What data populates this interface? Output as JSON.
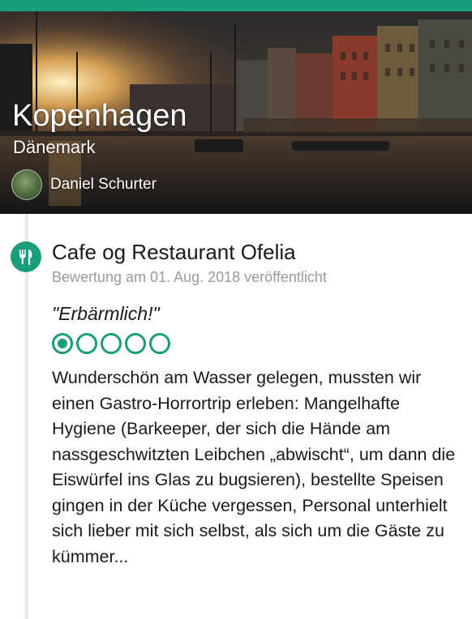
{
  "colors": {
    "accent": "#1a9d7a",
    "muted_text": "#9a9a9a",
    "text": "#1a1a1a"
  },
  "hero": {
    "city": "Kopenhagen",
    "country": "Dänemark",
    "author": "Daniel Schurter",
    "avatar_icon": "avatar"
  },
  "review": {
    "category_icon": "fork-knife-icon",
    "place": "Cafe og Restaurant Ofelia",
    "date": "Bewertung am 01. Aug. 2018 veröffentlicht",
    "title": "\"Erbärmlich!\"",
    "rating": 1,
    "rating_max": 5,
    "body": "Wunderschön am Wasser gelegen, mussten wir einen Gastro-Horrortrip erleben: Mangelhafte Hygiene (Barkeeper, der sich die Hände am nassgeschwitzten Leibchen „abwischt“, um dann die Eiswürfel ins Glas zu bugsieren), bestellte Speisen gingen in der Küche vergessen, Personal unterhielt sich lieber mit sich selbst, als sich um die Gäste zu kümmer..."
  }
}
